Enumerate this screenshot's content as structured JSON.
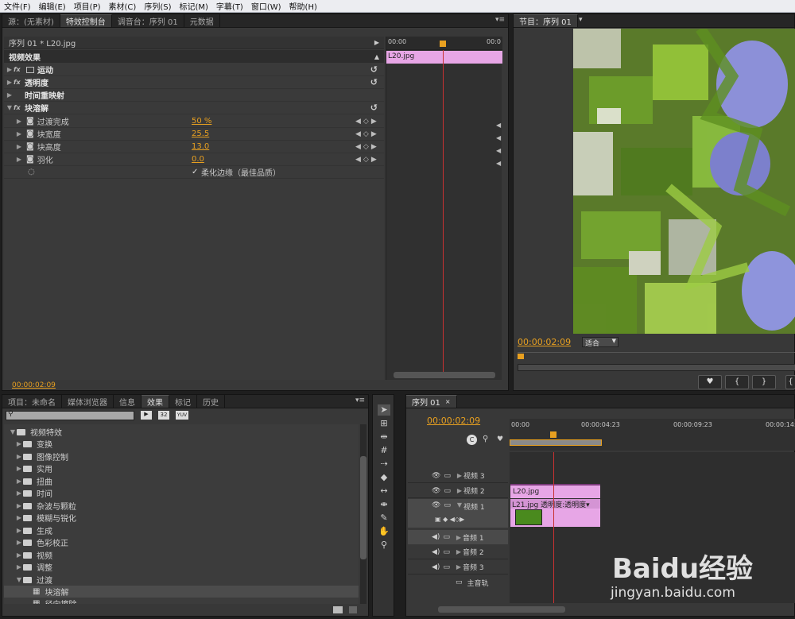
{
  "menu": [
    "文件(F)",
    "编辑(E)",
    "项目(P)",
    "素材(C)",
    "序列(S)",
    "标记(M)",
    "字幕(T)",
    "窗口(W)",
    "帮助(H)"
  ],
  "top_tabs": [
    "源：(无素材)",
    "特效控制台",
    "调音台：序列 01",
    "元数据"
  ],
  "effect_controls": {
    "clip_path": "序列 01 * L20.jpg",
    "section": "视频效果",
    "ruler_start": "00:00",
    "ruler_end": "00:0",
    "clip_label": "L20.jpg",
    "effects": [
      {
        "name": "运动"
      },
      {
        "name": "透明度"
      },
      {
        "name": "时间重映射"
      },
      {
        "name": "块溶解"
      }
    ],
    "params": [
      {
        "name": "过渡完成",
        "value": "50 %"
      },
      {
        "name": "块宽度",
        "value": "25.5"
      },
      {
        "name": "块高度",
        "value": "13.0"
      },
      {
        "name": "羽化",
        "value": "0.0"
      }
    ],
    "checkbox_label": "柔化边缘（最佳品质）",
    "timecode": "00:00:02:09"
  },
  "program": {
    "tab": "节目：序列 01",
    "timecode": "00:00:02:09",
    "fit": "适合"
  },
  "project_tabs": [
    "项目：未命名",
    "媒体浏览器",
    "信息",
    "效果",
    "标记",
    "历史"
  ],
  "effects_tree": {
    "root": "视频特效",
    "folders": [
      "变换",
      "图像控制",
      "实用",
      "扭曲",
      "时间",
      "杂波与颗粒",
      "模糊与锐化",
      "生成",
      "色彩校正",
      "视频",
      "调整",
      "过渡"
    ],
    "items": [
      "块溶解",
      "径向擦除"
    ],
    "buttons": [
      "32",
      "YUV"
    ]
  },
  "timeline": {
    "tab": "序列 01",
    "timecode": "00:00:02:09",
    "ruler": [
      "00:00",
      "00:00:04:23",
      "00:00:09:23",
      "00:00:14:"
    ],
    "tracks": {
      "v3": "视频 3",
      "v2": "视频 2",
      "v1": "视频 1",
      "a1": "音频 1",
      "a2": "音频 2",
      "a3": "音频 3",
      "master": "主音轨"
    },
    "clip_v2": "L20.jpg",
    "clip_v1": "L21.jpg  透明度:透明度▾"
  },
  "watermark": {
    "brand": "Baidu经验",
    "url": "jingyan.baidu.com"
  }
}
